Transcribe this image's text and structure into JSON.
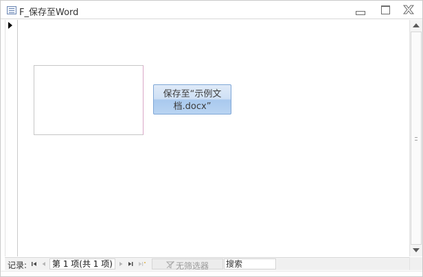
{
  "window": {
    "title": "F_保存至Word"
  },
  "form": {
    "save_button_label": "保存至“示例文档.docx”"
  },
  "navigation": {
    "record_label": "记录:",
    "record_position": "第 1 项(共 1 项)",
    "filter_label": "无筛选器",
    "search_text": "搜索"
  },
  "colors": {
    "button_border": "#7ea6d6",
    "button_top": "#dfeaf8",
    "button_bottom": "#a9c9ee",
    "selector_arrow": "#000000",
    "filter_text": "#9a9a9a"
  }
}
